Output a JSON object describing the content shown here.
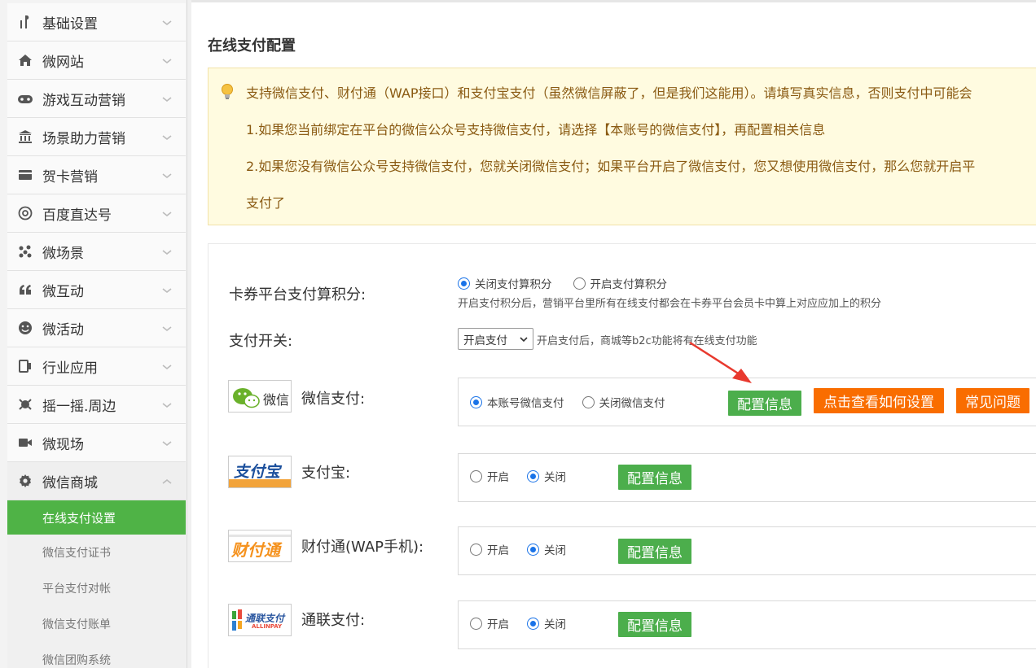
{
  "sidebar": {
    "items": [
      {
        "label": "基础设置",
        "icon": "tools-icon"
      },
      {
        "label": "微网站",
        "icon": "home-icon"
      },
      {
        "label": "游戏互动营销",
        "icon": "gamepad-icon"
      },
      {
        "label": "场景助力营销",
        "icon": "bank-icon"
      },
      {
        "label": "贺卡营销",
        "icon": "card-icon"
      },
      {
        "label": "百度直达号",
        "icon": "at-icon"
      },
      {
        "label": "微场景",
        "icon": "molecule-icon"
      },
      {
        "label": "微互动",
        "icon": "quote-icon"
      },
      {
        "label": "微活动",
        "icon": "smile-icon"
      },
      {
        "label": "行业应用",
        "icon": "device-icon"
      },
      {
        "label": "摇一摇.周边",
        "icon": "shake-icon"
      },
      {
        "label": "微现场",
        "icon": "video-icon"
      },
      {
        "label": "微信商城",
        "icon": "gear-icon"
      }
    ],
    "subitems": [
      {
        "label": "在线支付设置",
        "active": true
      },
      {
        "label": "微信支付证书"
      },
      {
        "label": "平台支付对帐"
      },
      {
        "label": "微信支付账单"
      },
      {
        "label": "微信团购系统"
      }
    ]
  },
  "page": {
    "title": "在线支付配置"
  },
  "notice": {
    "line1": "支持微信支付、财付通（WAP接口）和支付宝支付（虽然微信屏蔽了，但是我们这能用）。请填写真实信息，否则支付中可能会",
    "line2": "1.如果您当前绑定在平台的微信公众号支持微信支付，请选择【本账号的微信支付】，再配置相关信息",
    "line3": "2.如果您没有微信公众号支持微信支付，您就关闭微信支付；如果平台开启了微信支付，您又想使用微信支付，那么您就开启平",
    "line4": "支付了"
  },
  "points": {
    "label": "卡券平台支付算积分:",
    "options": [
      "关闭支付算积分",
      "开启支付算积分"
    ],
    "selected": 0,
    "hint": "开启支付积分后，营销平台里所有在线支付都会在卡券平台会员卡中算上对应应加上的积分"
  },
  "switch": {
    "label": "支付开关:",
    "value": "开启支付",
    "hint": "开启支付后，商城等b2c功能将有在线支付功能"
  },
  "wechat": {
    "logo_text": "微信",
    "label": "微信支付:",
    "options": [
      "本账号微信支付",
      "关闭微信支付"
    ],
    "selected": 0,
    "config_btn": "配置信息",
    "howto_btn": "点击查看如何设置",
    "faq_btn": "常见问题"
  },
  "alipay": {
    "logo_text": "支付宝",
    "label": "支付宝:",
    "options": [
      "开启",
      "关闭"
    ],
    "selected": 1,
    "config_btn": "配置信息"
  },
  "tenpay": {
    "logo_text": "财付通",
    "label": "财付通(WAP手机):",
    "options": [
      "开启",
      "关闭"
    ],
    "selected": 1,
    "config_btn": "配置信息"
  },
  "allinpay": {
    "logo_text": "通联支付",
    "logo_sub": "ALLINPAY",
    "label": "通联支付:",
    "options": [
      "开启",
      "关闭"
    ],
    "selected": 1,
    "config_btn": "配置信息"
  },
  "colors": {
    "green": "#4cae4c",
    "orange": "#f96d00",
    "active_menu": "#4fb346",
    "arrow": "#e8392e"
  }
}
